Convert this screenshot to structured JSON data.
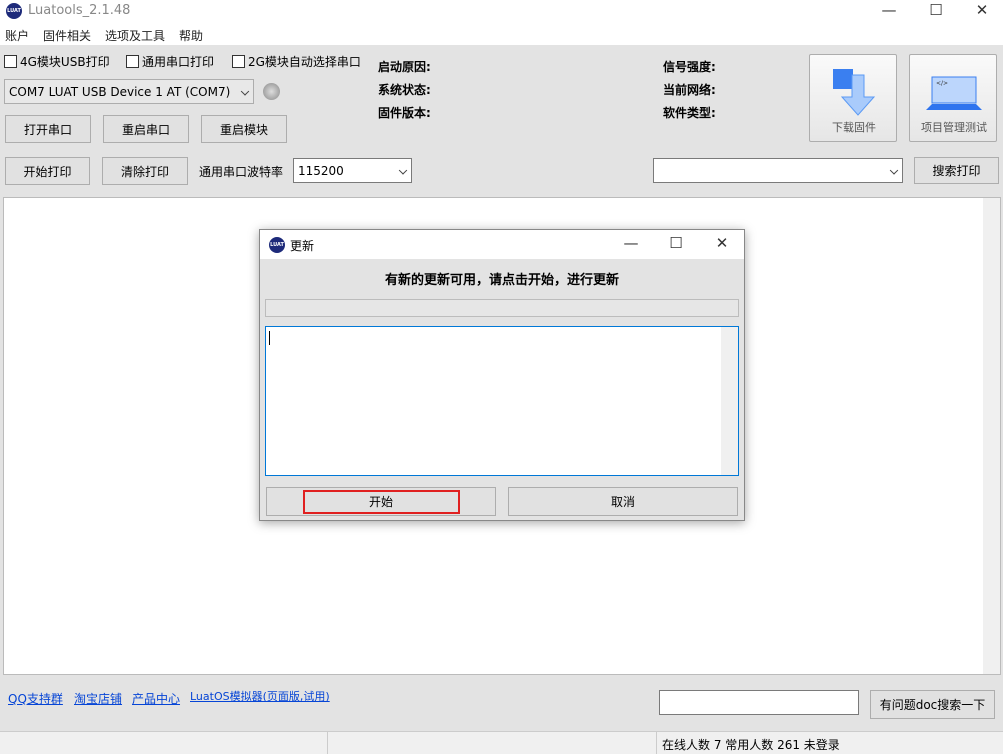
{
  "window": {
    "title": "Luatools_2.1.48",
    "minimize": "—",
    "maximize": "☐",
    "close": "✕"
  },
  "menu": [
    "账户",
    "固件相关",
    "选项及工具",
    "帮助"
  ],
  "checkboxes": [
    {
      "label": "4G模块USB打印",
      "checked": false
    },
    {
      "label": "通用串口打印",
      "checked": false
    },
    {
      "label": "2G模块自动选择串口",
      "checked": false
    }
  ],
  "port_select": {
    "value": "COM7 LUAT USB Device 1 AT (COM7)"
  },
  "buttons": {
    "open_port": "打开串口",
    "restart_port": "重启串口",
    "restart_module": "重启模块",
    "start_print": "开始打印",
    "clear_print": "清除打印",
    "search_print": "搜索打印",
    "doc_search": "有问题doc搜索一下"
  },
  "baud": {
    "label": "通用串口波特率",
    "value": "115200"
  },
  "info": {
    "boot_reason": "启动原因:",
    "system_status": "系统状态:",
    "firmware_version": "固件版本:",
    "signal": "信号强度:",
    "network": "当前网络:",
    "software_type": "软件类型:"
  },
  "big_buttons": {
    "download": "下载固件",
    "project": "项目管理测试"
  },
  "links": [
    "QQ支持群",
    "淘宝店铺",
    "产品中心",
    "LuatOS模拟器(页面版,试用)"
  ],
  "status": {
    "text": "在线人数 7 常用人数 261 未登录"
  },
  "dialog": {
    "title": "更新",
    "message": "有新的更新可用，请点击开始，进行更新",
    "progress": 0,
    "log": "",
    "start": "开始",
    "cancel": "取消"
  }
}
